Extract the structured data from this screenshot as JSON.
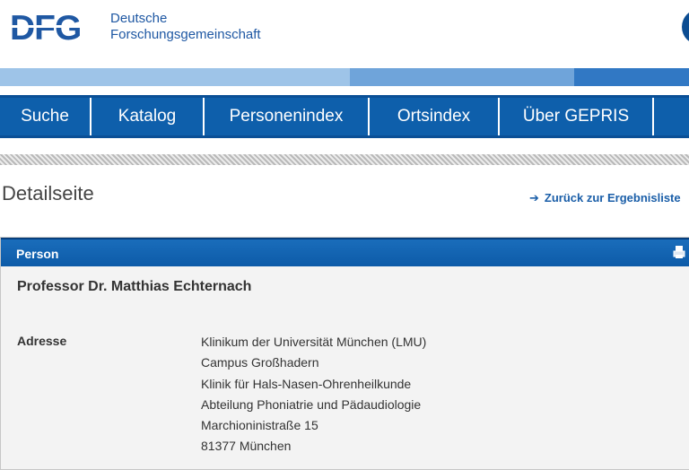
{
  "header": {
    "logo_text": "DFG",
    "org_line1": "Deutsche",
    "org_line2": "Forschungsgemeinschaft"
  },
  "nav": {
    "items": [
      "Suche",
      "Katalog",
      "Personenindex",
      "Ortsindex",
      "Über GEPRIS"
    ]
  },
  "page": {
    "title": "Detailseite",
    "back_link": "Zurück zur Ergebnisliste"
  },
  "panel": {
    "title": "Person",
    "person_name": "Professor Dr. Matthias Echternach",
    "address_label": "Adresse",
    "address_lines": [
      "Klinikum der Universität München (LMU)",
      "Campus Großhadern",
      "Klinik für Hals-Nasen-Ohrenheilkunde",
      "Abteilung Phoniatrie und Pädaudiologie",
      "Marchioninistraße 15",
      "81377 München"
    ]
  },
  "colors": {
    "nav_blue": "#0e5fab",
    "brand_blue": "#1f58a3",
    "link_blue": "#1a5ea8"
  },
  "icons": {
    "print": "printer-icon",
    "back": "arrow-right-icon"
  }
}
